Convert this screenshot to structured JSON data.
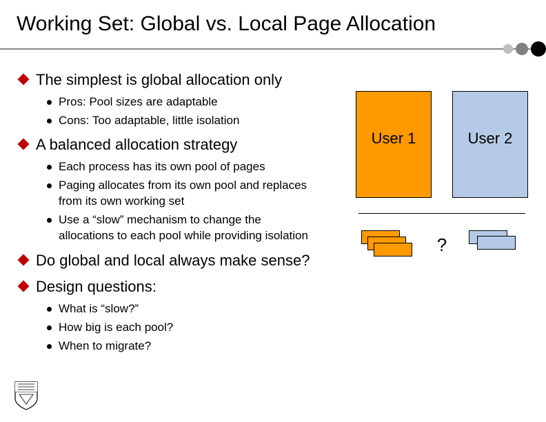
{
  "title": "Working Set: Global vs. Local Page Allocation",
  "bullets": {
    "b1": {
      "text": "The simplest is global allocation only",
      "sub": [
        "Pros: Pool sizes are adaptable",
        "Cons: Too adaptable, little isolation"
      ]
    },
    "b2": {
      "text": "A balanced allocation strategy",
      "sub": [
        "Each process has its own pool of pages",
        "Paging allocates from its own pool and replaces from its own working set",
        "Use a “slow” mechanism to change the allocations to each pool while providing isolation"
      ]
    },
    "b3": {
      "text": "Do global and local always make sense?"
    },
    "b4": {
      "text": "Design questions:",
      "sub": [
        "What is “slow?”",
        "How big is each pool?",
        "When to migrate?"
      ]
    }
  },
  "diagram": {
    "user1": "User 1",
    "user2": "User 2",
    "question": "?"
  }
}
